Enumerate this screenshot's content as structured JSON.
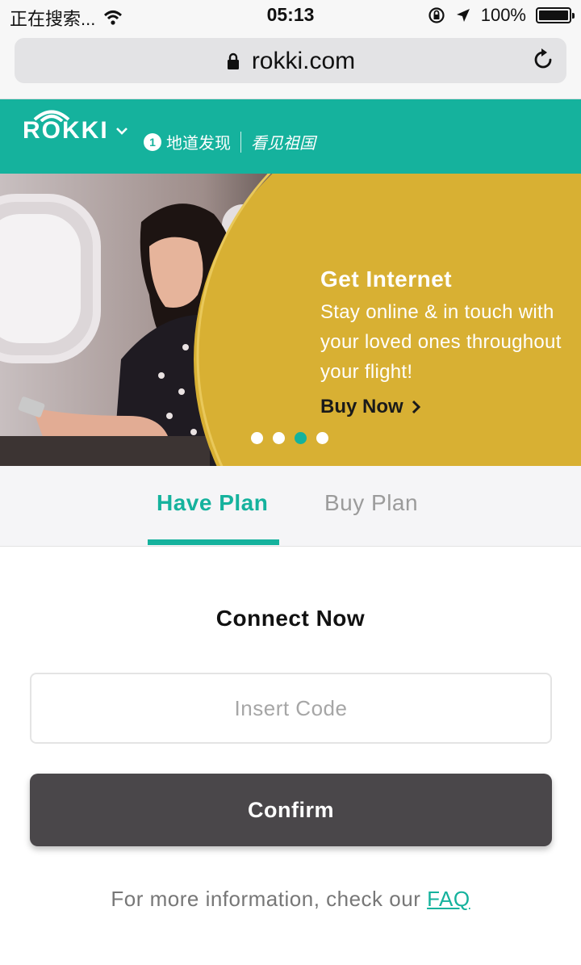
{
  "status_bar": {
    "carrier": "正在搜索...",
    "time": "05:13",
    "battery": "100%",
    "icons": [
      "wifi-icon",
      "rotation-lock-icon",
      "location-arrow-icon",
      "battery-icon"
    ]
  },
  "browser": {
    "url": "rokki.com",
    "icons": [
      "lock-icon",
      "reload-icon"
    ]
  },
  "header": {
    "logo": "ROKKI",
    "partner_name": "地道发现",
    "partner_script": "看见祖国",
    "colors": {
      "brand": "#15b29d"
    }
  },
  "hero": {
    "title": "Get Internet",
    "body": "Stay online & in touch with your loved ones throughout your flight!",
    "cta": "Buy Now",
    "carousel_active_index": 2,
    "carousel_count": 4,
    "colors": {
      "panel": "#d8b033"
    }
  },
  "tabs": [
    {
      "label": "Have Plan",
      "active": true
    },
    {
      "label": "Buy Plan",
      "active": false
    }
  ],
  "form": {
    "title": "Connect Now",
    "code_placeholder": "Insert Code",
    "code_value": "",
    "confirm_label": "Confirm",
    "info_text": "For more information, check our",
    "faq_label": "FAQ",
    "colors": {
      "button": "#4a474a"
    }
  }
}
